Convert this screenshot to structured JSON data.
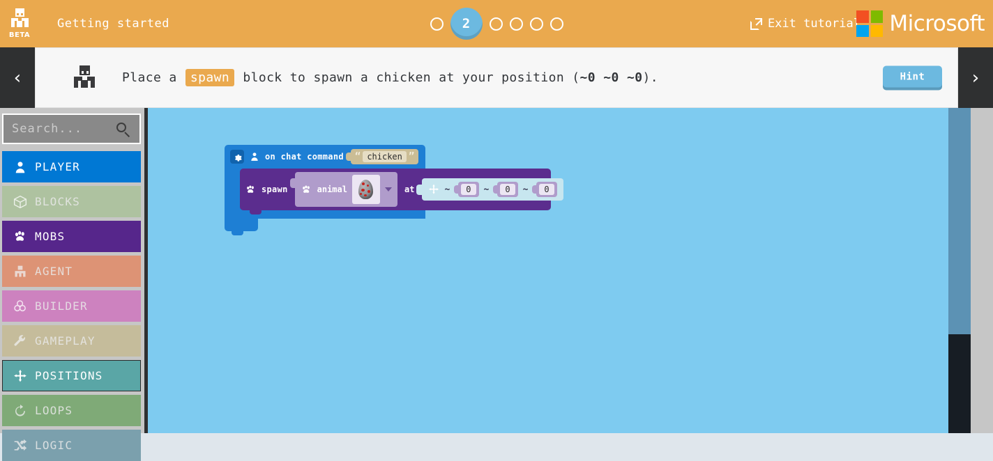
{
  "header": {
    "logo_icon": "minecraft-character-icon",
    "badge": "BETA",
    "title": "Getting started",
    "steps": {
      "total": 6,
      "current": 2,
      "current_label": "2"
    },
    "exit_label": "Exit tutorial",
    "exit_icon": "external-link-icon",
    "brand": "Microsoft",
    "brand_colors": [
      "#f25022",
      "#7fba00",
      "#00a4ef",
      "#ffb900"
    ],
    "bg_color": "#eaa94e"
  },
  "instruction": {
    "prev_icon": "chevron-left-icon",
    "next_icon": "chevron-right-icon",
    "avatar_icon": "minecraft-character-icon",
    "text_before": "Place a",
    "keyword": "spawn",
    "text_mid": "block to spawn a chicken at your position (",
    "coords": "~0 ~0 ~0",
    "text_after": ").",
    "hint_label": "Hint",
    "hint_color": "#6cb9e0"
  },
  "sidebar": {
    "search": {
      "placeholder": "Search...",
      "value": "",
      "icon": "search-icon"
    },
    "categories": [
      {
        "label": "PLAYER",
        "icon": "person-icon",
        "color": "#0078d4",
        "faded": false,
        "selected": false
      },
      {
        "label": "BLOCKS",
        "icon": "cube-icon",
        "color": "#aec2a0",
        "faded": true,
        "selected": false
      },
      {
        "label": "MOBS",
        "icon": "paw-icon",
        "color": "#56268b",
        "faded": false,
        "selected": false
      },
      {
        "label": "AGENT",
        "icon": "agent-icon",
        "color": "#dd9375",
        "faded": true,
        "selected": false
      },
      {
        "label": "BUILDER",
        "icon": "builder-icon",
        "color": "#cd82bf",
        "faded": true,
        "selected": false
      },
      {
        "label": "GAMEPLAY",
        "icon": "wrench-icon",
        "color": "#c5bc9b",
        "faded": true,
        "selected": false
      },
      {
        "label": "POSITIONS",
        "icon": "compass-icon",
        "color": "#5aa6a6",
        "faded": false,
        "selected": true
      },
      {
        "label": "LOOPS",
        "icon": "loop-icon",
        "color": "#7faa77",
        "faded": true,
        "selected": false
      },
      {
        "label": "LOGIC",
        "icon": "shuffle-icon",
        "color": "#7ba0ad",
        "faded": true,
        "selected": false
      }
    ]
  },
  "workspace": {
    "bg_color": "#7ecbf0",
    "blocks": {
      "event": {
        "gear_icon": "gear-icon",
        "person_icon": "person-icon",
        "label": "on chat command",
        "string_value": "chicken",
        "open_quote": "“",
        "close_quote": "”",
        "color": "#1e7fd4"
      },
      "spawn": {
        "paw_icon": "paw-icon",
        "label": "spawn",
        "dropdown_label": "animal",
        "dropdown_icon": "spawn-egg-icon",
        "dropdown_arrow": "chevron-down-icon",
        "at_label": "at",
        "color": "#5b2d8e"
      },
      "position": {
        "compass_icon": "compass-icon",
        "tilde": "~",
        "values": [
          "0",
          "0",
          "0"
        ],
        "color": "#c7e6ef"
      }
    }
  }
}
